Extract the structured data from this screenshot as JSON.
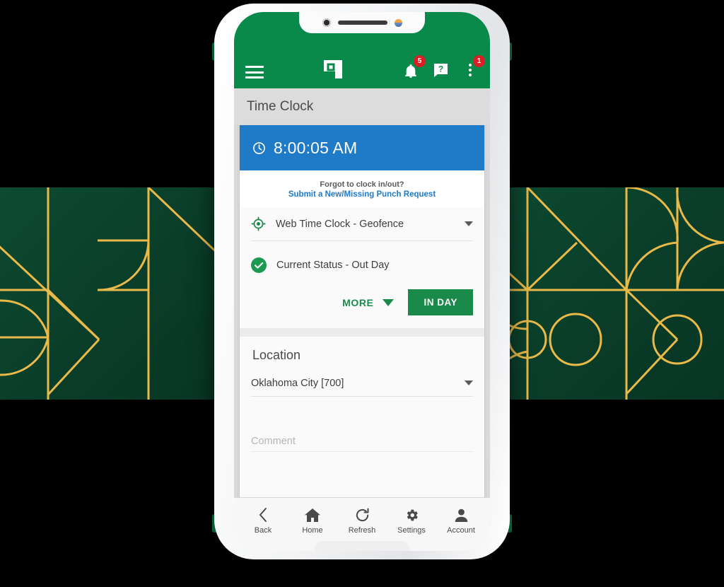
{
  "app": {
    "brand_green": "#0a8a4a",
    "accent_blue": "#1f7ac8",
    "badge_red": "#d81f26",
    "gold": "#e9b949"
  },
  "appbar": {
    "menu_label": "Menu",
    "logo_name": "Paycom logo",
    "notifications": {
      "icon": "bell-icon",
      "badge": "5"
    },
    "help": {
      "icon": "help-icon",
      "badge": ""
    },
    "overflow": {
      "icon": "kebab-menu-icon",
      "badge": "1"
    }
  },
  "page": {
    "title": "Time Clock"
  },
  "clock": {
    "icon": "clock-icon",
    "time": "8:00:05 AM"
  },
  "missing_punch": {
    "question": "Forgot to clock in/out?",
    "link": "Submit a New/Missing Punch Request"
  },
  "clock_type": {
    "icon": "geofence-target-icon",
    "value": "Web Time Clock - Geofence",
    "caret": "chevron-down-icon"
  },
  "status": {
    "icon": "check-circle-icon",
    "text": "Current Status - Out Day"
  },
  "actions": {
    "more_label": "MORE",
    "more_caret": "chevron-down-icon",
    "punch_label": "IN DAY"
  },
  "location": {
    "section_title": "Location",
    "value": "Oklahoma City [700]",
    "caret": "chevron-down-icon"
  },
  "comment": {
    "placeholder": "Comment",
    "value": ""
  },
  "bottom_nav": [
    {
      "icon": "back-chevron-icon",
      "label": "Back"
    },
    {
      "icon": "home-icon",
      "label": "Home"
    },
    {
      "icon": "refresh-icon",
      "label": "Refresh"
    },
    {
      "icon": "settings-gear-icon",
      "label": "Settings"
    },
    {
      "icon": "account-person-icon",
      "label": "Account"
    }
  ]
}
